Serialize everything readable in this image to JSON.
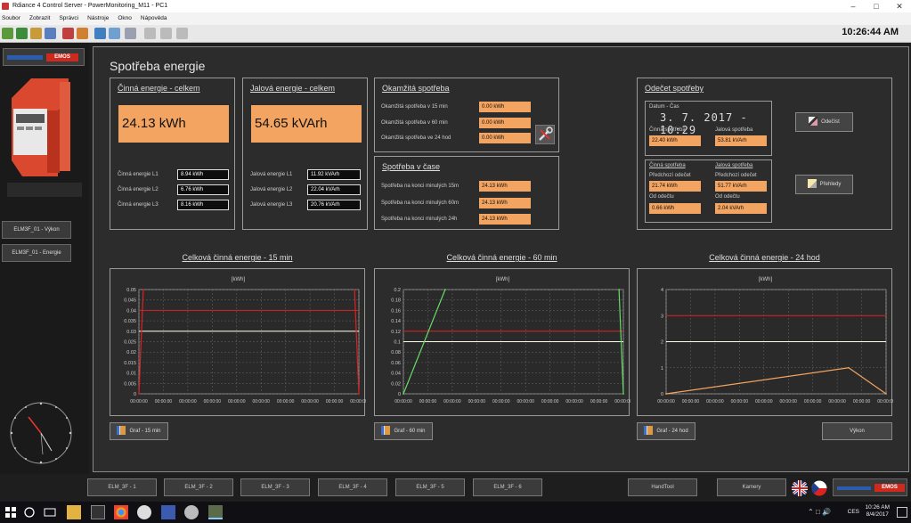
{
  "window": {
    "title": "Rdiance 4 Control Server - PowerMonitoring_M11 - PC1"
  },
  "menu": [
    "Soubor",
    "Zobrazit",
    "Správci",
    "Nástroje",
    "Okno",
    "Nápověda"
  ],
  "toolbar": {
    "clock": "10:26:44 AM"
  },
  "sidebar": {
    "brand_label": "EMOS",
    "buttons": [
      "ELM3F_01 - Výkon",
      "ELM3F_01 - Energie"
    ]
  },
  "main": {
    "title": "Spotřeba energie",
    "cinna": {
      "title": "Činná energie - celkem",
      "total": "24.13 kWh",
      "rows": [
        {
          "label": "Činná energie L1",
          "value": "8.94 kWh"
        },
        {
          "label": "Činná energie L2",
          "value": "6.76 kWh"
        },
        {
          "label": "Činná energie L3",
          "value": "8.16 kWh"
        }
      ]
    },
    "jalova": {
      "title": "Jalová energie - celkem",
      "total": "54.65 kVArh",
      "rows": [
        {
          "label": "Jalová energie L1",
          "value": "11.92 kVArh"
        },
        {
          "label": "Jalová energie L2",
          "value": "22.04 kVArh"
        },
        {
          "label": "Jalová energie L3",
          "value": "20.76 kVArh"
        }
      ]
    },
    "okamzita": {
      "title": "Okamžitá spotřeba",
      "rows": [
        {
          "label": "Okamžitá spotřeba v 15 min",
          "value": "0.00 kWh"
        },
        {
          "label": "Okamžitá spotřeba v 60 min",
          "value": "0.00 kWh"
        },
        {
          "label": "Okamžitá spotřeba ve 24 hod",
          "value": "0.00 kWh"
        }
      ]
    },
    "vcase": {
      "title": "Spotřeba v čase",
      "rows": [
        {
          "label": "Spotřeba na konci minulých 15m",
          "value": "24.13 kWh"
        },
        {
          "label": "Spotřeba na konci minulých 60m",
          "value": "24.13 kWh"
        },
        {
          "label": "Spotřeba na konci minulých 24h",
          "value": "24.13 kWh"
        }
      ]
    },
    "odecet": {
      "title": "Odečet spotřeby",
      "datetime_label": "Datum - Čas",
      "datetime_value": "3. 7. 2017 - 10:29",
      "cinna_label": "Činná spotřeba",
      "jalova_label": "Jalová spotřeba",
      "cinna_value": "22.40 kWh",
      "jalova_value": "53.81 kVArh",
      "cinna_label2": "Činná spotřeba",
      "jalova_label2": "Jalová spotřeba",
      "prev_label_c": "Předchozí odečet",
      "prev_label_j": "Předchozí odečet",
      "prev_c": "21.74 kWh",
      "prev_j": "51.77 kVArh",
      "since_label_c": "Od odečtu",
      "since_label_j": "Od odečtu",
      "since_c": "0.66 kWh",
      "since_j": "2.04 kVArh",
      "btn_odecet": "Odečíst",
      "btn_prehledy": "Přehledy"
    },
    "charts_titles": [
      "Celková činná energie - 15 min",
      "Celková činná energie - 60 min",
      "Celková činná energie - 24 hod"
    ],
    "chart_unit": "[kWh]",
    "chart_buttons": [
      "Graf - 15 min",
      "Graf - 60 min",
      "Graf - 24 hod"
    ],
    "btn_vykon": "Výkon"
  },
  "chart_data": [
    {
      "type": "line",
      "title": "Celková činná energie - 15 min",
      "ylabel": "[kWh]",
      "ylim": [
        0,
        0.05
      ],
      "yticks": [
        "0.05",
        "0.045",
        "0.04",
        "0.035",
        "0.03",
        "0.025",
        "0.02",
        "0.015",
        "0.01",
        "0.005",
        "0"
      ],
      "xticks": [
        "00:00:00",
        "00:00:00",
        "00:00:00",
        "00:00:00",
        "00:00:00",
        "00:00:00",
        "00:00:00",
        "00:00:00",
        "00:00:00",
        "00:00:00"
      ],
      "lines": [
        {
          "color": "#d22",
          "type": "hline",
          "value": 0.04
        },
        {
          "color": "#ffe",
          "type": "hline",
          "value": 0.03
        }
      ],
      "series": [
        {
          "color": "#d22",
          "x": [
            0.0,
            0.02
          ],
          "y": [
            0,
            0.05
          ]
        },
        {
          "color": "#d22",
          "x": [
            0.98,
            1.0
          ],
          "y": [
            0.05,
            0
          ]
        }
      ]
    },
    {
      "type": "line",
      "title": "Celková činná energie - 60 min",
      "ylabel": "[kWh]",
      "ylim": [
        0,
        0.2
      ],
      "yticks": [
        "0.2",
        "0.18",
        "0.16",
        "0.14",
        "0.12",
        "0.1",
        "0.08",
        "0.06",
        "0.04",
        "0.02",
        "0"
      ],
      "xticks": [
        "00:00:00",
        "00:00:00",
        "00:00:00",
        "00:00:00",
        "00:00:00",
        "00:00:00",
        "00:00:00",
        "00:00:00",
        "00:00:00",
        "00:00:00"
      ],
      "lines": [
        {
          "color": "#d22",
          "type": "hline",
          "value": 0.12
        },
        {
          "color": "#ffe",
          "type": "hline",
          "value": 0.1
        }
      ],
      "series": [
        {
          "color": "#6d6",
          "x": [
            0.0,
            0.19
          ],
          "y": [
            0,
            0.2
          ]
        },
        {
          "color": "#6d6",
          "x": [
            0.98,
            1.0
          ],
          "y": [
            0.2,
            0
          ]
        }
      ]
    },
    {
      "type": "line",
      "title": "Celková činná energie - 24 hod",
      "ylabel": "[kWh]",
      "ylim": [
        0,
        4
      ],
      "yticks": [
        "4",
        "3",
        "2",
        "1",
        "0"
      ],
      "xticks": [
        "00:00:00",
        "00:00:00",
        "00:00:00",
        "00:00:00",
        "00:00:00",
        "00:00:00",
        "00:00:00",
        "00:00:00",
        "00:00:00",
        "00:00:00"
      ],
      "lines": [
        {
          "color": "#d22",
          "type": "hline",
          "value": 3
        },
        {
          "color": "#ffe",
          "type": "hline",
          "value": 2
        }
      ],
      "series": [
        {
          "color": "#f2a460",
          "x": [
            0.0,
            0.83,
            1.0
          ],
          "y": [
            0,
            1,
            0
          ]
        }
      ]
    }
  ],
  "bottombar": {
    "buttons": [
      "ELM_3F - 1",
      "ELM_3F - 2",
      "ELM_3F - 3",
      "ELM_3F - 4",
      "ELM_3F - 5",
      "ELM_3F - 6"
    ],
    "handtool": "HandTool",
    "kamery": "Kamery"
  },
  "taskbar": {
    "time": "10:26 AM",
    "date": "8/4/2017",
    "lang": "CES"
  }
}
